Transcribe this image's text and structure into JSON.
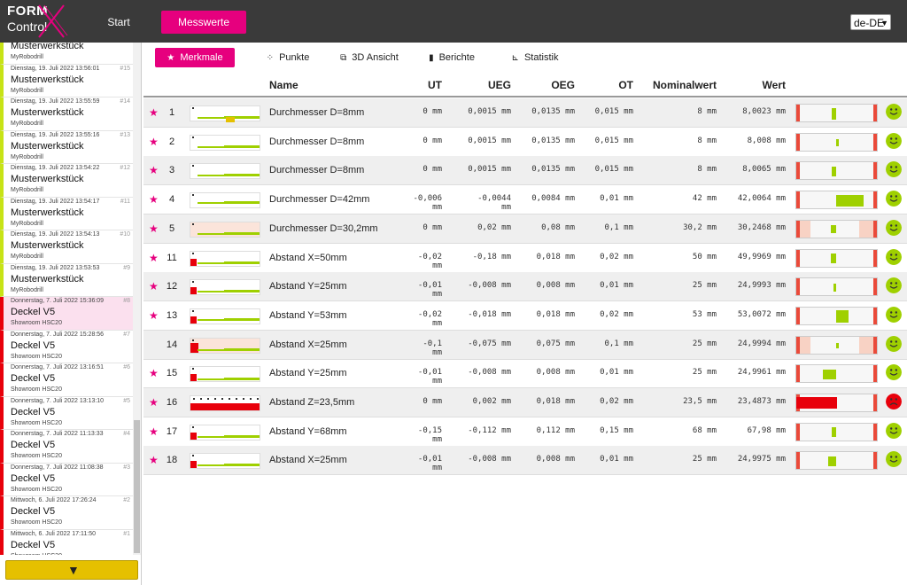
{
  "app": {
    "logo_line1": "FORM",
    "logo_line2": "Control",
    "nav": {
      "start": "Start",
      "messwerte": "Messwerte"
    },
    "language": "de-DE"
  },
  "colors": {
    "accent": "#e6007e",
    "ok": "#9fd000",
    "fail": "#e8000b",
    "filter": "#e5c000"
  },
  "sidebar": {
    "filter_icon": "filter-icon",
    "items": [
      {
        "date": "",
        "num": "",
        "title": "Musterwerkstück",
        "sub": "MyRobodrill",
        "status": "ok",
        "selected": false
      },
      {
        "date": "Dienstag, 19. Juli 2022 13:56:01",
        "num": "#15",
        "title": "Musterwerkstück",
        "sub": "MyRobodrill",
        "status": "ok",
        "selected": false
      },
      {
        "date": "Dienstag, 19. Juli 2022 13:55:59",
        "num": "#14",
        "title": "Musterwerkstück",
        "sub": "MyRobodrill",
        "status": "ok",
        "selected": false
      },
      {
        "date": "Dienstag, 19. Juli 2022 13:55:16",
        "num": "#13",
        "title": "Musterwerkstück",
        "sub": "MyRobodrill",
        "status": "ok",
        "selected": false
      },
      {
        "date": "Dienstag, 19. Juli 2022 13:54:22",
        "num": "#12",
        "title": "Musterwerkstück",
        "sub": "MyRobodrill",
        "status": "ok",
        "selected": false
      },
      {
        "date": "Dienstag, 19. Juli 2022 13:54:17",
        "num": "#11",
        "title": "Musterwerkstück",
        "sub": "MyRobodrill",
        "status": "ok",
        "selected": false
      },
      {
        "date": "Dienstag, 19. Juli 2022 13:54:13",
        "num": "#10",
        "title": "Musterwerkstück",
        "sub": "MyRobodrill",
        "status": "ok",
        "selected": false
      },
      {
        "date": "Dienstag, 19. Juli 2022 13:53:53",
        "num": "#9",
        "title": "Musterwerkstück",
        "sub": "MyRobodrill",
        "status": "ok",
        "selected": false
      },
      {
        "date": "Donnerstag, 7. Juli 2022 15:36:09",
        "num": "#8",
        "title": "Deckel V5",
        "sub": "Showroom HSC20",
        "status": "fail",
        "selected": true
      },
      {
        "date": "Donnerstag, 7. Juli 2022 15:28:56",
        "num": "#7",
        "title": "Deckel V5",
        "sub": "Showroom HSC20",
        "status": "fail",
        "selected": false
      },
      {
        "date": "Donnerstag, 7. Juli 2022 13:16:51",
        "num": "#6",
        "title": "Deckel V5",
        "sub": "Showroom HSC20",
        "status": "fail",
        "selected": false
      },
      {
        "date": "Donnerstag, 7. Juli 2022 13:13:10",
        "num": "#5",
        "title": "Deckel V5",
        "sub": "Showroom HSC20",
        "status": "fail",
        "selected": false
      },
      {
        "date": "Donnerstag, 7. Juli 2022 11:13:33",
        "num": "#4",
        "title": "Deckel V5",
        "sub": "Showroom HSC20",
        "status": "fail",
        "selected": false
      },
      {
        "date": "Donnerstag, 7. Juli 2022 11:08:38",
        "num": "#3",
        "title": "Deckel V5",
        "sub": "Showroom HSC20",
        "status": "fail",
        "selected": false
      },
      {
        "date": "Mittwoch, 6. Juli 2022 17:26:24",
        "num": "#2",
        "title": "Deckel V5",
        "sub": "Showroom HSC20",
        "status": "fail",
        "selected": false
      },
      {
        "date": "Mittwoch, 6. Juli 2022 17:11:50",
        "num": "#1",
        "title": "Deckel V5",
        "sub": "Showroom HSC20",
        "status": "fail",
        "selected": false
      }
    ]
  },
  "tabs": [
    {
      "label": "Merkmale",
      "icon": "star-icon",
      "glyph": "★",
      "active": true
    },
    {
      "label": "Punkte",
      "icon": "points-icon",
      "glyph": "⁘",
      "active": false
    },
    {
      "label": "3D Ansicht",
      "icon": "cube-icon",
      "glyph": "⧉",
      "active": false
    },
    {
      "label": "Berichte",
      "icon": "document-icon",
      "glyph": "▮",
      "active": false
    },
    {
      "label": "Statistik",
      "icon": "chart-icon",
      "glyph": "⊾",
      "active": false
    }
  ],
  "table": {
    "headers": {
      "name": "Name",
      "ut": "UT",
      "ueg": "UEG",
      "oeg": "OEG",
      "ot": "OT",
      "nominal": "Nominalwert",
      "wert": "Wert"
    },
    "rows": [
      {
        "starred": true,
        "nr": "1",
        "name": "Durchmesser D=8mm",
        "ut": "0 mm",
        "ueg": "0,0015 mm",
        "oeg": "0,0135 mm",
        "ot": "0,015 mm",
        "nominal": "8 mm",
        "wert": "8,0023 mm",
        "status": "ok",
        "level": 0.43,
        "warnzone": false
      },
      {
        "starred": true,
        "nr": "2",
        "name": "Durchmesser D=8mm",
        "ut": "0 mm",
        "ueg": "0,0015 mm",
        "oeg": "0,0135 mm",
        "ot": "0,015 mm",
        "nominal": "8 mm",
        "wert": "8,008 mm",
        "status": "ok",
        "level": 0.53,
        "warnzone": false
      },
      {
        "starred": true,
        "nr": "3",
        "name": "Durchmesser D=8mm",
        "ut": "0 mm",
        "ueg": "0,0015 mm",
        "oeg": "0,0135 mm",
        "ot": "0,015 mm",
        "nominal": "8 mm",
        "wert": "8,0065 mm",
        "status": "ok",
        "level": 0.43,
        "warnzone": false
      },
      {
        "starred": true,
        "nr": "4",
        "name": "Durchmesser D=42mm",
        "ut": "-0,006 mm",
        "ueg": "-0,0044 mm",
        "oeg": "0,0084 mm",
        "ot": "0,01 mm",
        "nominal": "42 mm",
        "wert": "42,0064 mm",
        "status": "ok",
        "level": 0.9,
        "warnzone": false
      },
      {
        "starred": true,
        "nr": "5",
        "name": "Durchmesser D=30,2mm",
        "ut": "0 mm",
        "ueg": "0,02 mm",
        "oeg": "0,08 mm",
        "ot": "0,1 mm",
        "nominal": "30,2 mm",
        "wert": "30,2468 mm",
        "status": "ok",
        "level": 0.42,
        "warnzone": true
      },
      {
        "starred": true,
        "nr": "11",
        "name": "Abstand X=50mm",
        "ut": "-0,02 mm",
        "ueg": "-0,18 mm",
        "oeg": "0,018 mm",
        "ot": "0,02 mm",
        "nominal": "50 mm",
        "wert": "49,9969 mm",
        "status": "ok",
        "level": 0.42,
        "warnzone": false
      },
      {
        "starred": true,
        "nr": "12",
        "name": "Abstand Y=25mm",
        "ut": "-0,01 mm",
        "ueg": "-0,008 mm",
        "oeg": "0,008 mm",
        "ot": "0,01 mm",
        "nominal": "25 mm",
        "wert": "24,9993 mm",
        "status": "ok",
        "level": 0.46,
        "warnzone": false
      },
      {
        "starred": true,
        "nr": "13",
        "name": "Abstand Y=53mm",
        "ut": "-0,02 mm",
        "ueg": "-0,018 mm",
        "oeg": "0,018 mm",
        "ot": "0,02 mm",
        "nominal": "53 mm",
        "wert": "53,0072 mm",
        "status": "ok",
        "level": 0.68,
        "warnzone": false
      },
      {
        "starred": false,
        "nr": "14",
        "name": "Abstand X=25mm",
        "ut": "-0,1 mm",
        "ueg": "-0,075 mm",
        "oeg": "0,075 mm",
        "ot": "0,1 mm",
        "nominal": "25 mm",
        "wert": "24,9994 mm",
        "status": "ok",
        "level": 0.5,
        "warnzone": true
      },
      {
        "starred": true,
        "nr": "15",
        "name": "Abstand Y=25mm",
        "ut": "-0,01 mm",
        "ueg": "-0,008 mm",
        "oeg": "0,008 mm",
        "ot": "0,01 mm",
        "nominal": "25 mm",
        "wert": "24,9961 mm",
        "status": "ok",
        "level": 0.31,
        "warnzone": false
      },
      {
        "starred": true,
        "nr": "16",
        "name": "Abstand Z=23,5mm",
        "ut": "0 mm",
        "ueg": "0,002 mm",
        "oeg": "0,018 mm",
        "ot": "0,02 mm",
        "nominal": "23,5 mm",
        "wert": "23,4873 mm",
        "status": "fail",
        "level": 0.0,
        "warnzone": false
      },
      {
        "starred": true,
        "nr": "17",
        "name": "Abstand Y=68mm",
        "ut": "-0,15 mm",
        "ueg": "-0,112 mm",
        "oeg": "0,112 mm",
        "ot": "0,15 mm",
        "nominal": "68 mm",
        "wert": "67,98 mm",
        "status": "ok",
        "level": 0.43,
        "warnzone": false
      },
      {
        "starred": true,
        "nr": "18",
        "name": "Abstand X=25mm",
        "ut": "-0,01 mm",
        "ueg": "-0,008 mm",
        "oeg": "0,008 mm",
        "ot": "0,01 mm",
        "nominal": "25 mm",
        "wert": "24,9975 mm",
        "status": "ok",
        "level": 0.38,
        "warnzone": false
      }
    ]
  }
}
